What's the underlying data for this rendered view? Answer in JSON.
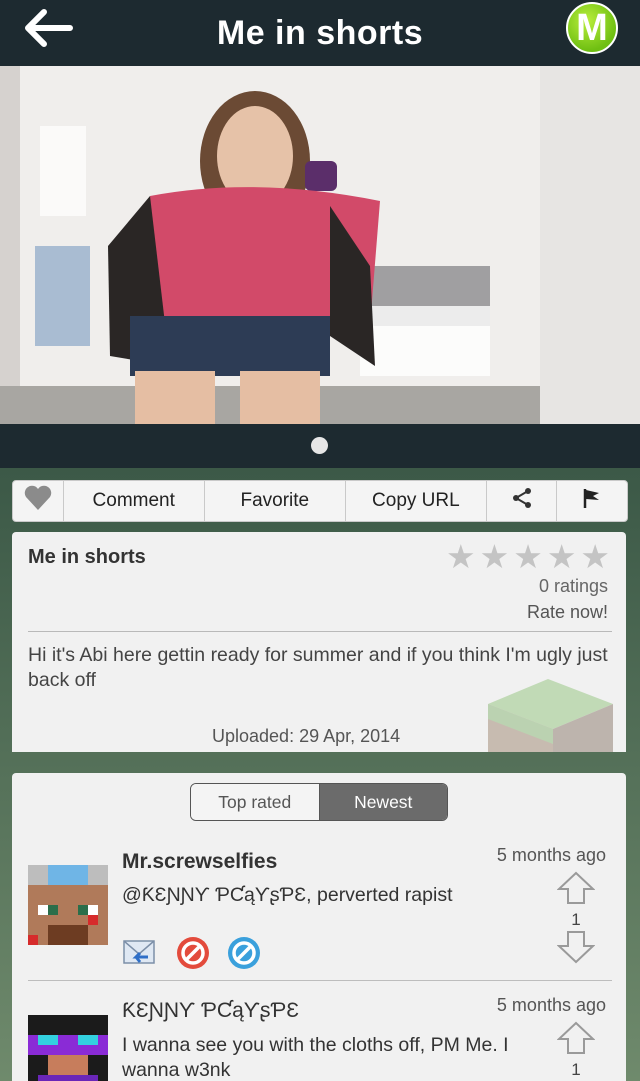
{
  "header": {
    "title": "Me in shorts",
    "back_icon": "back-arrow-icon",
    "app_logo": "M"
  },
  "actions": {
    "like_icon": "heart-icon",
    "comment": "Comment",
    "favorite": "Favorite",
    "copy_url": "Copy URL",
    "share_icon": "share-icon",
    "flag_icon": "flag-icon"
  },
  "post": {
    "title": "Me in shorts",
    "stars_total": 5,
    "stars_filled": 0,
    "ratings": "0 ratings",
    "rate_now": "Rate now!",
    "description": "Hi it's Abi here gettin ready for summer and if you think I'm ugly just back off",
    "uploaded": "Uploaded: 29 Apr, 2014"
  },
  "comments_tabs": {
    "top_rated": "Top rated",
    "newest": "Newest",
    "selected": "Newest"
  },
  "comments": [
    {
      "user": "Mr.screwselfies",
      "time": "5 months ago",
      "text": "@ƘƐƝƝƳ ƤƇąƳʂƤƐ, perverted rapist",
      "votes": "1"
    },
    {
      "user": "ƘƐƝƝƳ ƤƇąƳʂƤƐ",
      "time": "5 months ago",
      "text": "I wanna see you with the cloths off, PM Me. I wanna w3nk",
      "votes": "1"
    }
  ],
  "colors": {
    "header_bg": "#1d2a30",
    "logo_green": "#7ccf1a",
    "card_bg": "#f1f1f1"
  }
}
